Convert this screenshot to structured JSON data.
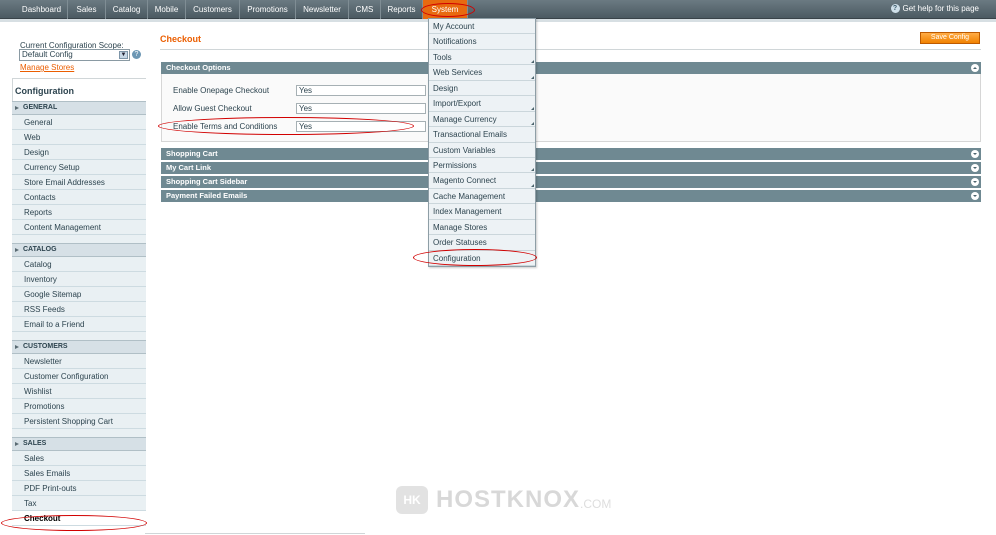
{
  "topnav": {
    "items": [
      "Dashboard",
      "Sales",
      "Catalog",
      "Mobile",
      "Customers",
      "Promotions",
      "Newsletter",
      "CMS",
      "Reports",
      "System"
    ],
    "active": "System",
    "help": "Get help for this page",
    "help_icon": "?"
  },
  "scope": {
    "label": "Current Configuration Scope:",
    "value": "Default Config",
    "manage_stores": "Manage Stores"
  },
  "sidebar": {
    "title": "Configuration",
    "sections": [
      {
        "label": "GENERAL",
        "items": [
          "General",
          "Web",
          "Design",
          "Currency Setup",
          "Store Email Addresses",
          "Contacts",
          "Reports",
          "Content Management"
        ]
      },
      {
        "label": "CATALOG",
        "items": [
          "Catalog",
          "Inventory",
          "Google Sitemap",
          "RSS Feeds",
          "Email to a Friend"
        ]
      },
      {
        "label": "CUSTOMERS",
        "items": [
          "Newsletter",
          "Customer Configuration",
          "Wishlist",
          "Promotions",
          "Persistent Shopping Cart"
        ]
      },
      {
        "label": "SALES",
        "items": [
          "Sales",
          "Sales Emails",
          "PDF Print-outs",
          "Tax",
          "Checkout"
        ]
      }
    ],
    "current": "Checkout"
  },
  "main": {
    "title": "Checkout",
    "save_button": "Save Config",
    "groups": [
      {
        "label": "Checkout Options",
        "expanded": true
      },
      {
        "label": "Shopping Cart",
        "expanded": false
      },
      {
        "label": "My Cart Link",
        "expanded": false
      },
      {
        "label": "Shopping Cart Sidebar",
        "expanded": false
      },
      {
        "label": "Payment Failed Emails",
        "expanded": false
      }
    ],
    "options": [
      {
        "label": "Enable Onepage Checkout",
        "value": "Yes"
      },
      {
        "label": "Allow Guest Checkout",
        "value": "Yes"
      },
      {
        "label": "Enable Terms and Conditions",
        "value": "Yes"
      }
    ]
  },
  "system_menu": {
    "items": [
      {
        "label": "My Account",
        "submenu": false
      },
      {
        "label": "Notifications",
        "submenu": false
      },
      {
        "label": "Tools",
        "submenu": true
      },
      {
        "label": "Web Services",
        "submenu": true
      },
      {
        "label": "Design",
        "submenu": false
      },
      {
        "label": "Import/Export",
        "submenu": true
      },
      {
        "label": "Manage Currency",
        "submenu": true
      },
      {
        "label": "Transactional Emails",
        "submenu": false
      },
      {
        "label": "Custom Variables",
        "submenu": false
      },
      {
        "label": "Permissions",
        "submenu": true
      },
      {
        "label": "Magento Connect",
        "submenu": true
      },
      {
        "label": "Cache Management",
        "submenu": false
      },
      {
        "label": "Index Management",
        "submenu": false
      },
      {
        "label": "Manage Stores",
        "submenu": false
      },
      {
        "label": "Order Statuses",
        "submenu": false
      },
      {
        "label": "Configuration",
        "submenu": false
      }
    ]
  },
  "watermark": {
    "logo": "HK",
    "text": "HOSTKNOX",
    "domain": ".COM"
  },
  "colors": {
    "accent": "#eb5e00",
    "nav_bg": "#5b6a72",
    "group_head": "#6f8992",
    "annotation": "#d10000"
  }
}
